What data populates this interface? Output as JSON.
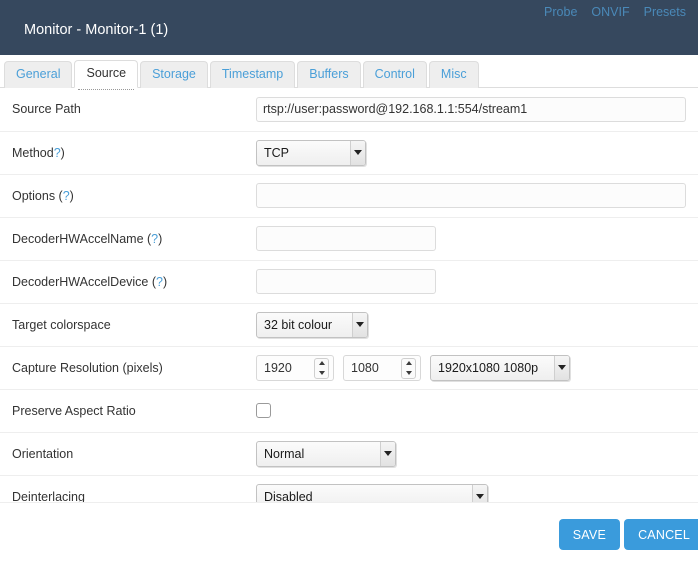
{
  "header": {
    "title": "Monitor - Monitor-1 (1)",
    "links": [
      {
        "label": "Probe"
      },
      {
        "label": "ONVIF"
      },
      {
        "label": "Presets"
      }
    ]
  },
  "tabs": [
    {
      "label": "General",
      "active": false
    },
    {
      "label": "Source",
      "active": true
    },
    {
      "label": "Storage",
      "active": false
    },
    {
      "label": "Timestamp",
      "active": false
    },
    {
      "label": "Buffers",
      "active": false
    },
    {
      "label": "Control",
      "active": false
    },
    {
      "label": "Misc",
      "active": false
    }
  ],
  "form": {
    "source_path": {
      "label": "Source Path",
      "value": "rtsp://user:password@192.168.1.1:554/stream1",
      "placeholder": ""
    },
    "method": {
      "label": "Method",
      "hint": "?",
      "suffix": ")",
      "value": "TCP"
    },
    "options": {
      "label_prefix": "Options (",
      "hint": "?",
      "label_suffix": ")",
      "value": "",
      "placeholder": ""
    },
    "decoder_hwaccel_name": {
      "label_prefix": "DecoderHWAccelName (",
      "hint": "?",
      "label_suffix": ")",
      "value": "",
      "placeholder": ""
    },
    "decoder_hwaccel_device": {
      "label_prefix": "DecoderHWAccelDevice (",
      "hint": "?",
      "label_suffix": ")",
      "value": "",
      "placeholder": ""
    },
    "target_colorspace": {
      "label": "Target colorspace",
      "value": "32 bit colour"
    },
    "capture_resolution": {
      "label": "Capture Resolution (pixels)",
      "width": "1920",
      "height": "1080",
      "preset": "1920x1080 1080p"
    },
    "preserve_aspect_ratio": {
      "label": "Preserve Aspect Ratio",
      "checked": false
    },
    "orientation": {
      "label": "Orientation",
      "value": "Normal"
    },
    "deinterlacing": {
      "label": "Deinterlacing",
      "value": "Disabled"
    }
  },
  "footer": {
    "save_label": "SAVE",
    "cancel_label": "CANCEL"
  },
  "colors": {
    "header_bg": "#36485e",
    "header_link": "#4a89b8",
    "accent": "#3a9bdc",
    "tab_link": "#4a9fd8"
  }
}
